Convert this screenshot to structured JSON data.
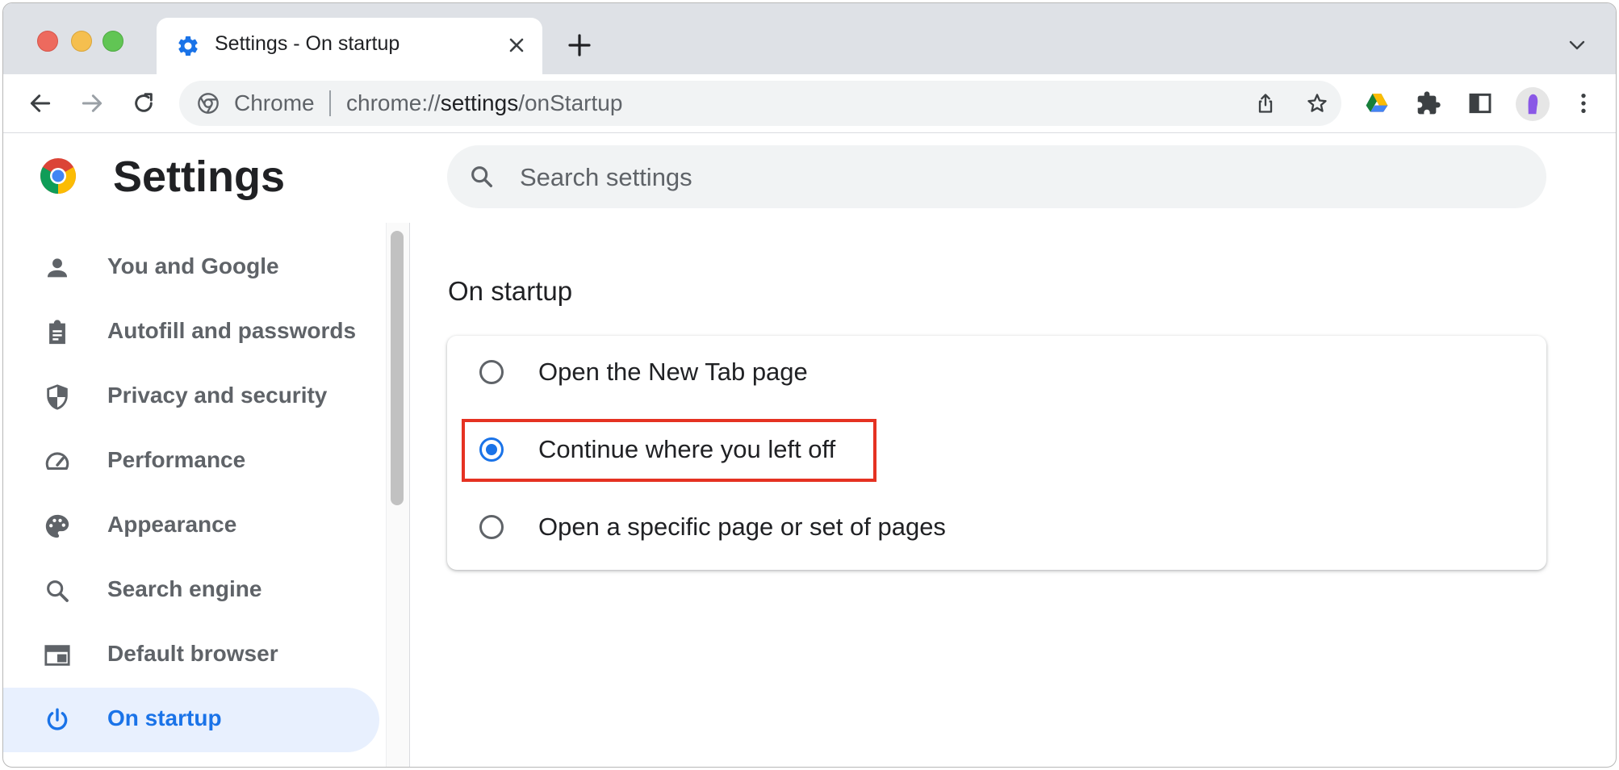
{
  "browser": {
    "tab": {
      "title": "Settings - On startup",
      "favicon": "gear-icon"
    },
    "omnibox": {
      "chip": "Chrome",
      "url_scheme": "chrome://",
      "url_host": "settings",
      "url_path": "/onStartup"
    },
    "toolbar_icons": [
      "back-arrow-icon",
      "forward-arrow-icon",
      "reload-icon",
      "share-icon",
      "bookmark-star-icon",
      "google-drive-icon",
      "extensions-icon",
      "side-panel-icon",
      "profile-avatar",
      "more-menu-icon"
    ]
  },
  "settings": {
    "title": "Settings",
    "search": {
      "placeholder": "Search settings"
    }
  },
  "sidebar": {
    "items": [
      {
        "label": "You and Google",
        "icon": "person-icon"
      },
      {
        "label": "Autofill and passwords",
        "icon": "clipboard-icon"
      },
      {
        "label": "Privacy and security",
        "icon": "shield-icon"
      },
      {
        "label": "Performance",
        "icon": "speedometer-icon"
      },
      {
        "label": "Appearance",
        "icon": "palette-icon"
      },
      {
        "label": "Search engine",
        "icon": "search-icon"
      },
      {
        "label": "Default browser",
        "icon": "browser-window-icon"
      },
      {
        "label": "On startup",
        "icon": "power-icon",
        "active": true
      }
    ]
  },
  "main": {
    "section_title": "On startup",
    "options": [
      {
        "label": "Open the New Tab page",
        "selected": false
      },
      {
        "label": "Continue where you left off",
        "selected": true
      },
      {
        "label": "Open a specific page or set of pages",
        "selected": false
      }
    ]
  },
  "colors": {
    "accent": "#1a73e8",
    "highlight_box": "#e53222",
    "active_nav_bg": "#e8f0fe"
  }
}
